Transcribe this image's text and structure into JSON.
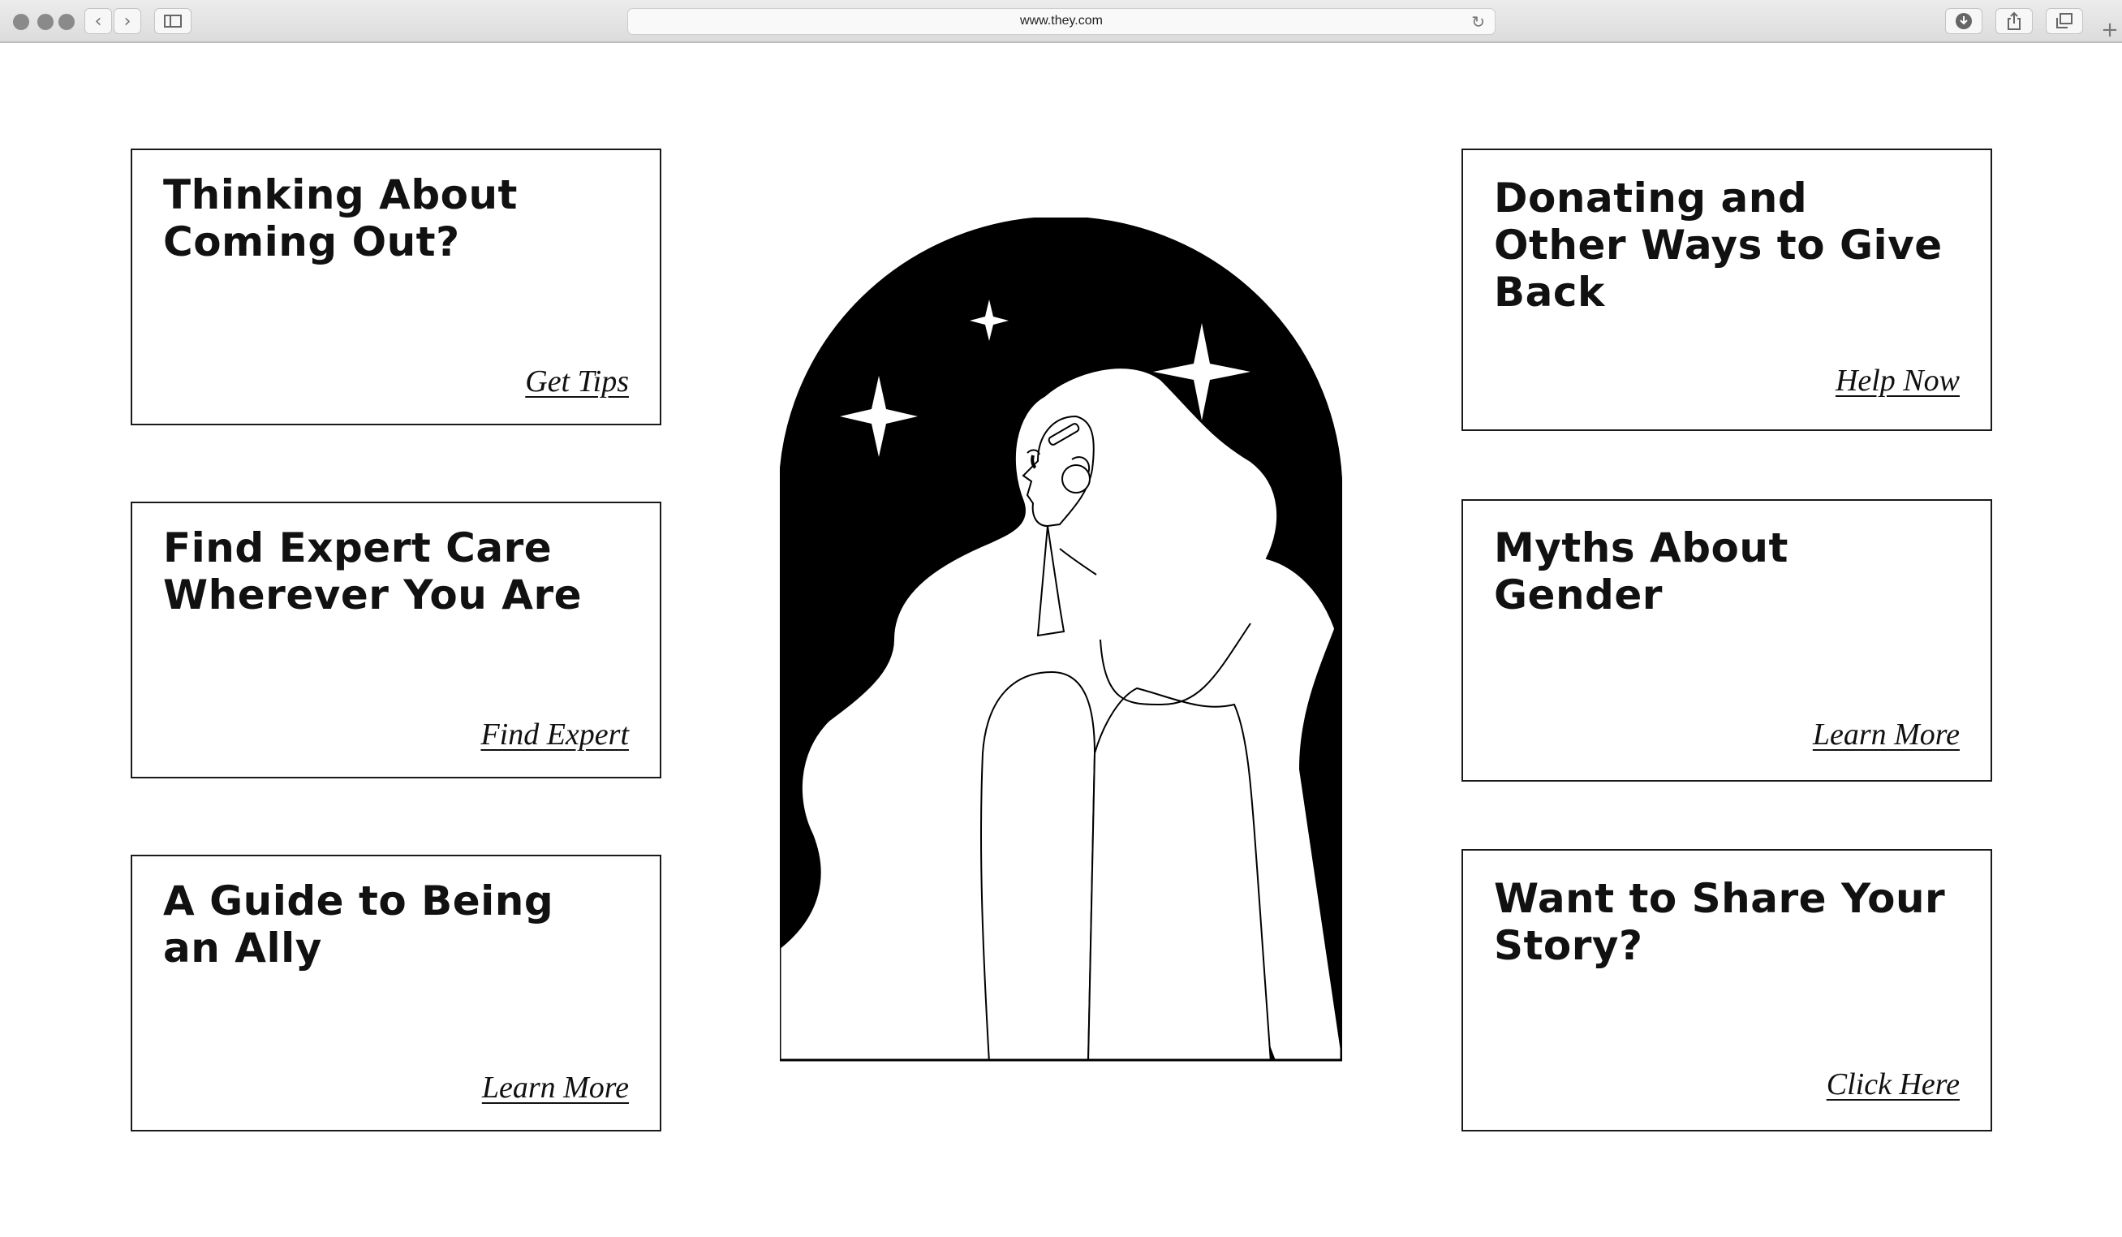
{
  "browser": {
    "url": "www.they.com"
  },
  "cards": [
    {
      "title": "Thinking About Coming Out?",
      "link": "Get Tips"
    },
    {
      "title": "Find Expert Care Wherever You Are",
      "link": "Find Expert"
    },
    {
      "title": "A Guide to Being an Ally",
      "link": "Learn More"
    },
    {
      "title": "Donating and Other Ways to Give Back",
      "link": "Help Now"
    },
    {
      "title": "Myths About Gender",
      "link": "Learn More"
    },
    {
      "title": "Want to Share Your Story?",
      "link": "Click Here"
    }
  ],
  "icons": {
    "back": "chevron-left-icon",
    "forward": "chevron-right-icon",
    "sidebar": "sidebar-icon",
    "reload": "reload-icon",
    "download": "download-icon",
    "share": "share-icon",
    "tabs": "tabs-icon",
    "new_tab": "plus-icon"
  },
  "colors": {
    "ink": "#111111",
    "background": "#ffffff",
    "chrome": "#e4e4e4"
  }
}
